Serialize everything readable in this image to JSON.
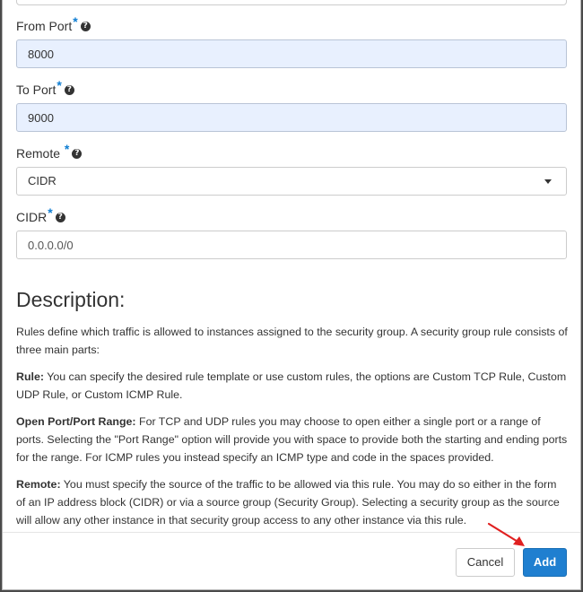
{
  "form": {
    "from_port": {
      "label": "From Port",
      "required_mark": "*",
      "help": "?",
      "value": "8000"
    },
    "to_port": {
      "label": "To Port",
      "required_mark": "*",
      "help": "?",
      "value": "9000"
    },
    "remote": {
      "label": "Remote",
      "required_mark": "*",
      "help": "?",
      "selected": "CIDR"
    },
    "cidr": {
      "label": "CIDR",
      "required_mark": "*",
      "help": "?",
      "value": "0.0.0.0/0"
    }
  },
  "description": {
    "heading": "Description:",
    "intro": "Rules define which traffic is allowed to instances assigned to the security group. A security group rule consists of three main parts:",
    "rule_term": "Rule:",
    "rule_text": " You can specify the desired rule template or use custom rules, the options are Custom TCP Rule, Custom UDP Rule, or Custom ICMP Rule.",
    "port_term": "Open Port/Port Range:",
    "port_text": " For TCP and UDP rules you may choose to open either a single port or a range of ports. Selecting the \"Port Range\" option will provide you with space to provide both the starting and ending ports for the range. For ICMP rules you instead specify an ICMP type and code in the spaces provided.",
    "remote_term": "Remote:",
    "remote_text": " You must specify the source of the traffic to be allowed via this rule. You may do so either in the form of an IP address block (CIDR) or via a source group (Security Group). Selecting a security group as the source will allow any other instance in that security group access to any other instance via this rule."
  },
  "footer": {
    "cancel_label": "Cancel",
    "add_label": "Add"
  },
  "icons": {
    "help": "question-circle-icon",
    "caret": "caret-down-icon",
    "annotation": "red-arrow-icon"
  },
  "colors": {
    "primary": "#1f7fd0",
    "required": "#0e7dd2",
    "autofill_bg": "#e8f0fe",
    "annotation": "#e02020"
  }
}
